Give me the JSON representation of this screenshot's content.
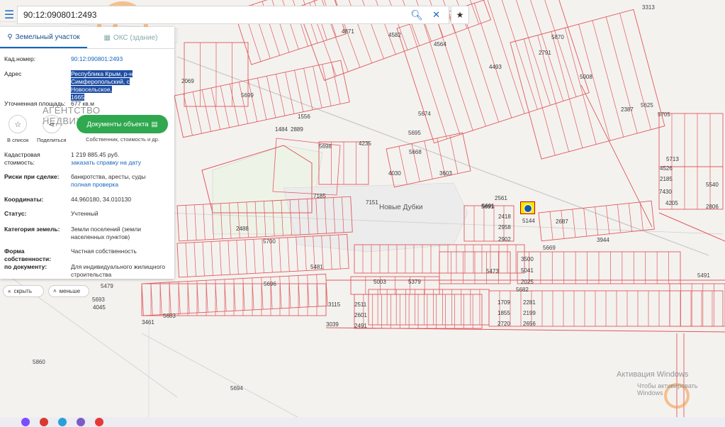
{
  "search": {
    "value": "90:12:090801:2493"
  },
  "panel": {
    "tab_active": "Земельный участок",
    "tab_inactive": "ОКС (здание)",
    "watermark": "АГЕНТСТВО НЕДВИЖИМОСТИ",
    "fields": {
      "cad_number_label": "Кад.номер:",
      "cad_number_value": "90:12:090801:2493",
      "address_label": "Адрес",
      "address_line1": "Республика Крым, р-н",
      "address_line2": "Симферопольский, с Новосельское,",
      "address_line3": "1665",
      "area_label": "Уточненная площадь:",
      "area_value": "677 кв.м",
      "cad_cost_label": "Кадастровая стоимость:",
      "cad_cost_value": "1 219 885.45 руб.",
      "cad_cost_link": "заказать справку на дату",
      "risks_label": "Риски при сделке:",
      "risks_value": "банкротства, аресты, суды",
      "risks_link": "полная проверка",
      "coords_label": "Координаты:",
      "coords_value": "44.960180, 34.010130",
      "status_label": "Статус:",
      "status_value": "Учтенный",
      "category_label": "Категория земель:",
      "category_value": "Земли поселений (земли населенных пунктов)",
      "ownership_label": "Форма собственности:",
      "ownership_value": "Частная собственность",
      "document_label": "по документу:",
      "document_value": "Для индивидуального жилищного строительства"
    },
    "actions": {
      "to_list": "В список",
      "share": "Поделиться",
      "docs_button": "Документы объекта",
      "docs_sub": "Собственник, стоимость и др."
    }
  },
  "controls": {
    "hide": "скрыть",
    "less": "меньше"
  },
  "map": {
    "place_name": "Новые Дубки",
    "top_right_number": "3313",
    "road_labels": [
      "5699",
      "5698",
      "5668",
      "5691",
      "5700",
      "5696",
      "5683",
      "5682",
      "5669",
      "5479",
      "5491",
      "5694",
      "5860",
      "5625",
      "5705",
      "5713",
      "5870",
      "5674",
      "5695",
      "5693"
    ],
    "selected_plot": "5144"
  },
  "windows": {
    "activate_line1": "Активация Windows",
    "activate_line2": "Чтобы активировать Windows"
  },
  "colors": {
    "parcel": "#e0585c",
    "accent": "#1565c0",
    "button": "#2fa84f",
    "highlight": "#1f4fa5",
    "selected": "#f3e800"
  }
}
